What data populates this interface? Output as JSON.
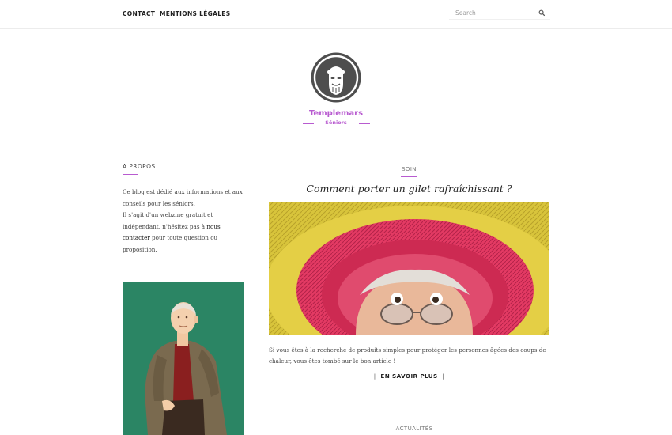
{
  "nav": {
    "contact": "CONTACT",
    "legal": "MENTIONS LÉGALES"
  },
  "search": {
    "placeholder": "Search",
    "icon": "search-icon"
  },
  "site": {
    "title": "Templemars",
    "subtitle": "Séniors",
    "logo_icon": "bearded-man-logo",
    "accent_color": "#b85bd0"
  },
  "sidebar": {
    "about_title": "A PROPOS",
    "about_line1": "Ce blog est dédié aux informations et aux conseils pour les séniors.",
    "about_line2_before": "Il s'agit d'un webzine gratuit et indépendant, n'hésitez pas à ",
    "about_link": "nous contacter",
    "about_line2_after": " pour toute question ou proposition.",
    "portrait_bg": "#2b8564"
  },
  "post": {
    "category": "SOIN",
    "title": "Comment porter un gilet rafraîchissant ?",
    "excerpt": "Si vous êtes à la recherche de produits simples pour protéger les personnes âgées des coups de chaleur, vous êtes tombé sur le bon article !",
    "read_more": "EN SAVOIR PLUS",
    "read_more_bar": "|"
  },
  "next_post": {
    "category": "ACTUALITÉS"
  }
}
